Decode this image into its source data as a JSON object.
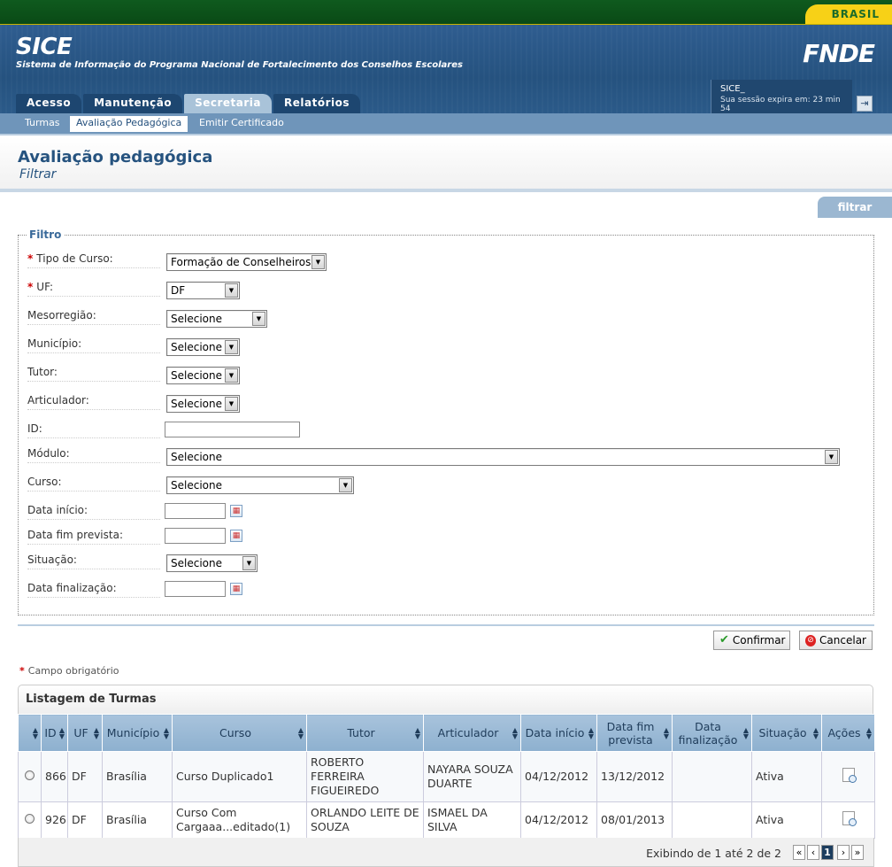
{
  "top": {
    "brasil": "BRASIL"
  },
  "header": {
    "app": "SICE",
    "subtitle": "Sistema de Informação do Programa Nacional de Fortalecimento dos Conselhos Escolares",
    "logo": "FNDE"
  },
  "mainnav": [
    {
      "label": "Acesso"
    },
    {
      "label": "Manutenção"
    },
    {
      "label": "Secretaria",
      "active": true
    },
    {
      "label": "Relatórios"
    }
  ],
  "session": {
    "user": "SICE_",
    "expires": "Sua sessão expira em: 23 min 54"
  },
  "subnav": [
    {
      "label": "Turmas"
    },
    {
      "label": "Avaliação Pedagógica",
      "active": true
    },
    {
      "label": "Emitir Certificado"
    }
  ],
  "page": {
    "title": "Avaliação pedagógica",
    "subtitle": "Filtrar",
    "filter_tab": "filtrar"
  },
  "filter": {
    "legend": "Filtro",
    "tipo_curso": {
      "label": "Tipo de Curso:",
      "value": "Formação de Conselheiros"
    },
    "uf": {
      "label": "UF:",
      "value": "DF"
    },
    "mesorregiao": {
      "label": "Mesorregião:",
      "value": "Selecione"
    },
    "municipio": {
      "label": "Município:",
      "value": "Selecione"
    },
    "tutor": {
      "label": "Tutor:",
      "value": "Selecione"
    },
    "articulador": {
      "label": "Articulador:",
      "value": "Selecione"
    },
    "id": {
      "label": "ID:",
      "value": ""
    },
    "modulo": {
      "label": "Módulo:",
      "value": "Selecione"
    },
    "curso": {
      "label": "Curso:",
      "value": "Selecione"
    },
    "data_inicio": {
      "label": "Data início:",
      "value": ""
    },
    "data_fim": {
      "label": "Data fim prevista:",
      "value": ""
    },
    "situacao": {
      "label": "Situação:",
      "value": "Selecione"
    },
    "data_final": {
      "label": "Data finalização:",
      "value": ""
    }
  },
  "buttons": {
    "confirm": "Confirmar",
    "cancel": "Cancelar"
  },
  "required_note": "Campo obrigatório",
  "listing": {
    "title": "Listagem de Turmas",
    "columns": [
      "ID",
      "UF",
      "Município",
      "Curso",
      "Tutor",
      "Articulador",
      "Data início",
      "Data fim prevista",
      "Data finalização",
      "Situação",
      "Ações"
    ],
    "rows": [
      {
        "id": "866",
        "uf": "DF",
        "municipio": "Brasília",
        "curso": "Curso Duplicado1",
        "tutor": "ROBERTO FERREIRA FIGUEIREDO",
        "articulador": "NAYARA SOUZA DUARTE",
        "inicio": "04/12/2012",
        "fim": "13/12/2012",
        "final": "",
        "situacao": "Ativa"
      },
      {
        "id": "926",
        "uf": "DF",
        "municipio": "Brasília",
        "curso": "Curso Com Cargaaa...editado(1)",
        "tutor": "ORLANDO LEITE DE SOUZA",
        "articulador": "ISMAEL DA SILVA",
        "inicio": "04/12/2012",
        "fim": "08/01/2013",
        "final": "",
        "situacao": "Ativa"
      }
    ],
    "showing": "Exibindo de 1 até 2 de 2",
    "page": "1"
  },
  "colors": {
    "header_blue": "#25527f",
    "gov_green": "#0f5a1e",
    "brasil_yellow": "#f7d117",
    "table_header": "#8db0cf"
  },
  "icons": {
    "calendar": "calendar-icon",
    "confirm": "check-icon",
    "cancel": "cancel-icon",
    "view": "view-document-icon",
    "logout": "logout-icon"
  }
}
